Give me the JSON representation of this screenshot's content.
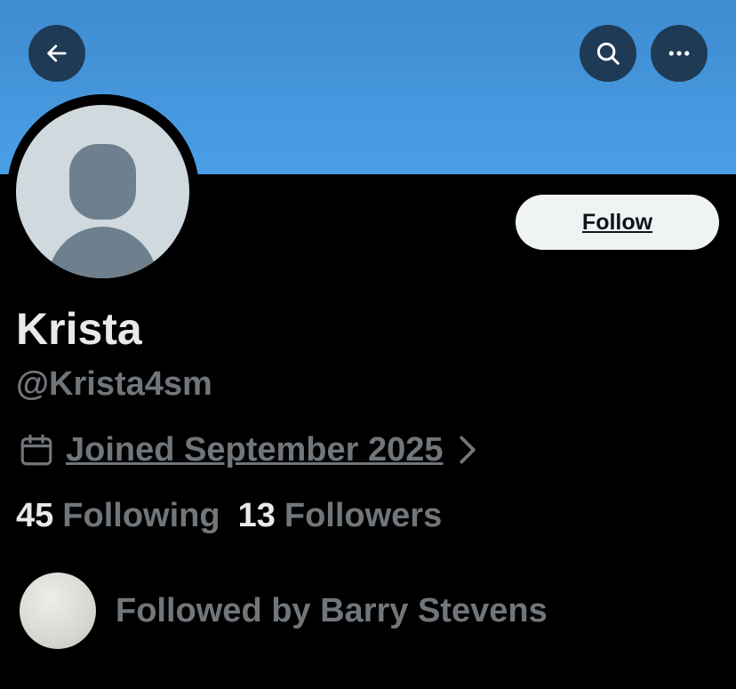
{
  "profile": {
    "display_name": "Krista",
    "handle": "@Krista4sm",
    "joined": "Joined September 2025",
    "following_count": "45",
    "following_label": "Following",
    "followers_count": "13",
    "followers_label": "Followers",
    "followed_by": "Followed by Barry Stevens"
  },
  "actions": {
    "follow_label": "Follow",
    "back_icon": "arrow-left-icon",
    "search_icon": "search-icon",
    "more_icon": "more-horizontal-icon"
  },
  "colors": {
    "banner": "#4a9fe6",
    "background": "#000000",
    "primary_text": "#e7e9ea",
    "secondary_text": "#71767b",
    "follow_button_bg": "#eff3f4",
    "header_button_bg": "#1e3a55"
  }
}
